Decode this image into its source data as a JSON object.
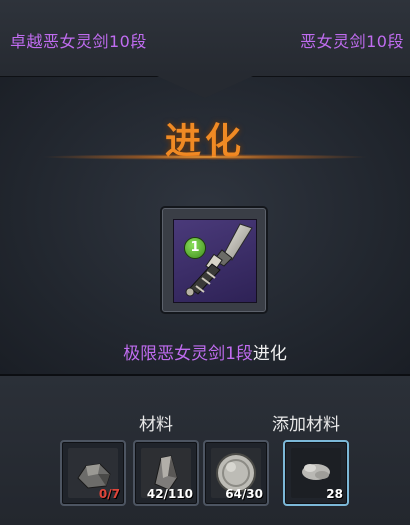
{
  "header": {
    "source_item": "卓越恶女灵剑10段",
    "target_item": "恶女灵剑10段"
  },
  "evolution": {
    "title": "进化",
    "result": {
      "grade_badge": "1",
      "item_name": "极限恶女灵剑1段",
      "action_word": "进化",
      "icon": "sword-hilt-icon"
    }
  },
  "materials": {
    "label": "材料",
    "slots": [
      {
        "icon": "ore-chunk-icon",
        "count": "0/7"
      },
      {
        "icon": "crystal-shard-icon",
        "count": "42/110"
      },
      {
        "icon": "silver-coin-icon",
        "count": "64/30"
      }
    ]
  },
  "extra_materials": {
    "label": "添加材料",
    "slot": {
      "icon": "powder-pile-icon",
      "count": "28"
    }
  },
  "colors": {
    "title": "#f08a24",
    "item_name": "#c06cf0",
    "count_insufficient": "#e0453a",
    "count_sufficient": "#ffffff"
  }
}
